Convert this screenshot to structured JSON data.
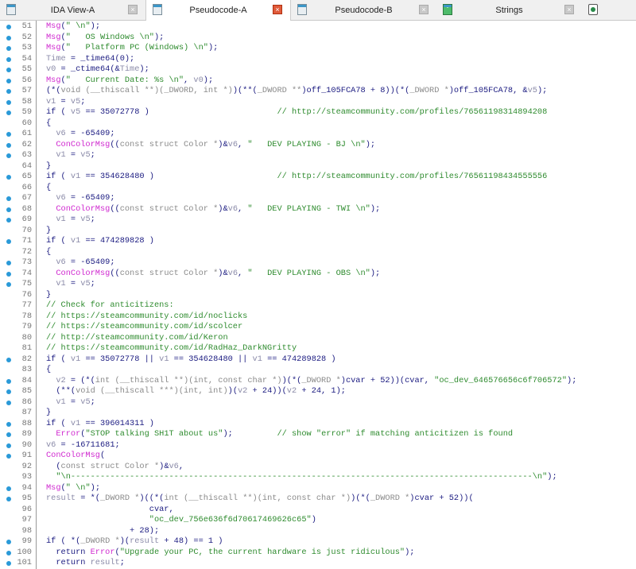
{
  "tabs": [
    {
      "label": "IDA View-A",
      "icon": "disassembly-icon",
      "active": false
    },
    {
      "label": "Pseudocode-A",
      "icon": "pseudocode-icon",
      "active": true
    },
    {
      "label": "Pseudocode-B",
      "icon": "pseudocode-icon",
      "active": false
    },
    {
      "label": "Strings",
      "icon": "strings-icon",
      "active": false
    }
  ],
  "accent": "#2a9ad8",
  "lines": [
    {
      "n": "51",
      "bp": true,
      "seg": [
        [
          "f",
          "Msg"
        ],
        [
          "n",
          "("
        ],
        [
          "s",
          "\" \\n\""
        ],
        [
          "n",
          ");"
        ]
      ]
    },
    {
      "n": "52",
      "bp": true,
      "seg": [
        [
          "f",
          "Msg"
        ],
        [
          "n",
          "("
        ],
        [
          "s",
          "\"   OS Windows \\n\""
        ],
        [
          "n",
          ");"
        ]
      ]
    },
    {
      "n": "53",
      "bp": true,
      "seg": [
        [
          "f",
          "Msg"
        ],
        [
          "n",
          "("
        ],
        [
          "s",
          "\"   Platform PC (Windows) \\n\""
        ],
        [
          "n",
          ");"
        ]
      ]
    },
    {
      "n": "54",
      "bp": true,
      "seg": [
        [
          "v",
          "Time"
        ],
        [
          "n",
          " = _time64(0);"
        ]
      ]
    },
    {
      "n": "55",
      "bp": true,
      "seg": [
        [
          "v",
          "v0"
        ],
        [
          "n",
          " = _ctime64(&"
        ],
        [
          "v",
          "Time"
        ],
        [
          "n",
          ");"
        ]
      ]
    },
    {
      "n": "56",
      "bp": true,
      "seg": [
        [
          "f",
          "Msg"
        ],
        [
          "n",
          "("
        ],
        [
          "s",
          "\"   Current Date: %s \\n\""
        ],
        [
          "n",
          ", "
        ],
        [
          "v",
          "v0"
        ],
        [
          "n",
          ");"
        ]
      ]
    },
    {
      "n": "57",
      "bp": true,
      "seg": [
        [
          "n",
          "(*("
        ],
        [
          "t",
          "void (__thiscall **)(_DWORD, int *)"
        ],
        [
          "n",
          ")(**("
        ],
        [
          "t",
          "_DWORD **"
        ],
        [
          "n",
          ")off_105FCA78 + 8))(*("
        ],
        [
          "t",
          "_DWORD *"
        ],
        [
          "n",
          ")off_105FCA78, &"
        ],
        [
          "v",
          "v5"
        ],
        [
          "n",
          ");"
        ]
      ]
    },
    {
      "n": "58",
      "bp": true,
      "seg": [
        [
          "v",
          "v1"
        ],
        [
          "n",
          " = "
        ],
        [
          "v",
          "v5"
        ],
        [
          "n",
          ";"
        ]
      ]
    },
    {
      "n": "59",
      "bp": true,
      "seg": [
        [
          "n",
          "if ( "
        ],
        [
          "v",
          "v5"
        ],
        [
          "n",
          " == 35072778 )                          "
        ],
        [
          "s",
          "// http://steamcommunity.com/profiles/76561198314894208"
        ]
      ]
    },
    {
      "n": "60",
      "bp": false,
      "seg": [
        [
          "n",
          "{"
        ]
      ]
    },
    {
      "n": "61",
      "bp": true,
      "seg": [
        [
          "n",
          "  "
        ],
        [
          "v",
          "v6"
        ],
        [
          "n",
          " = -65409;"
        ]
      ]
    },
    {
      "n": "62",
      "bp": true,
      "seg": [
        [
          "n",
          "  "
        ],
        [
          "f",
          "ConColorMsg"
        ],
        [
          "n",
          "(("
        ],
        [
          "t",
          "const struct Color *"
        ],
        [
          "n",
          ")&"
        ],
        [
          "v",
          "v6"
        ],
        [
          "n",
          ", "
        ],
        [
          "s",
          "\"   DEV PLAYING - BJ \\n\""
        ],
        [
          "n",
          ");"
        ]
      ]
    },
    {
      "n": "63",
      "bp": true,
      "seg": [
        [
          "n",
          "  "
        ],
        [
          "v",
          "v1"
        ],
        [
          "n",
          " = "
        ],
        [
          "v",
          "v5"
        ],
        [
          "n",
          ";"
        ]
      ]
    },
    {
      "n": "64",
      "bp": false,
      "seg": [
        [
          "n",
          "}"
        ]
      ]
    },
    {
      "n": "65",
      "bp": true,
      "seg": [
        [
          "n",
          "if ( "
        ],
        [
          "v",
          "v1"
        ],
        [
          "n",
          " == 354628480 )                         "
        ],
        [
          "s",
          "// http://steamcommunity.com/profiles/76561198434555556"
        ]
      ]
    },
    {
      "n": "66",
      "bp": false,
      "seg": [
        [
          "n",
          "{"
        ]
      ]
    },
    {
      "n": "67",
      "bp": true,
      "seg": [
        [
          "n",
          "  "
        ],
        [
          "v",
          "v6"
        ],
        [
          "n",
          " = -65409;"
        ]
      ]
    },
    {
      "n": "68",
      "bp": true,
      "seg": [
        [
          "n",
          "  "
        ],
        [
          "f",
          "ConColorMsg"
        ],
        [
          "n",
          "(("
        ],
        [
          "t",
          "const struct Color *"
        ],
        [
          "n",
          ")&"
        ],
        [
          "v",
          "v6"
        ],
        [
          "n",
          ", "
        ],
        [
          "s",
          "\"   DEV PLAYING - TWI \\n\""
        ],
        [
          "n",
          ");"
        ]
      ]
    },
    {
      "n": "69",
      "bp": true,
      "seg": [
        [
          "n",
          "  "
        ],
        [
          "v",
          "v1"
        ],
        [
          "n",
          " = "
        ],
        [
          "v",
          "v5"
        ],
        [
          "n",
          ";"
        ]
      ]
    },
    {
      "n": "70",
      "bp": false,
      "seg": [
        [
          "n",
          "}"
        ]
      ]
    },
    {
      "n": "71",
      "bp": true,
      "seg": [
        [
          "n",
          "if ( "
        ],
        [
          "v",
          "v1"
        ],
        [
          "n",
          " == 474289828 )"
        ]
      ]
    },
    {
      "n": "72",
      "bp": false,
      "seg": [
        [
          "n",
          "{"
        ]
      ]
    },
    {
      "n": "73",
      "bp": true,
      "seg": [
        [
          "n",
          "  "
        ],
        [
          "v",
          "v6"
        ],
        [
          "n",
          " = -65409;"
        ]
      ]
    },
    {
      "n": "74",
      "bp": true,
      "seg": [
        [
          "n",
          "  "
        ],
        [
          "f",
          "ConColorMsg"
        ],
        [
          "n",
          "(("
        ],
        [
          "t",
          "const struct Color *"
        ],
        [
          "n",
          ")&"
        ],
        [
          "v",
          "v6"
        ],
        [
          "n",
          ", "
        ],
        [
          "s",
          "\"   DEV PLAYING - OBS \\n\""
        ],
        [
          "n",
          ");"
        ]
      ]
    },
    {
      "n": "75",
      "bp": true,
      "seg": [
        [
          "n",
          "  "
        ],
        [
          "v",
          "v1"
        ],
        [
          "n",
          " = "
        ],
        [
          "v",
          "v5"
        ],
        [
          "n",
          ";"
        ]
      ]
    },
    {
      "n": "76",
      "bp": false,
      "seg": [
        [
          "n",
          "}"
        ]
      ]
    },
    {
      "n": "77",
      "bp": false,
      "seg": [
        [
          "s",
          "// Check for anticitizens:"
        ]
      ]
    },
    {
      "n": "78",
      "bp": false,
      "seg": [
        [
          "s",
          "// https://steamcommunity.com/id/noclicks"
        ]
      ]
    },
    {
      "n": "79",
      "bp": false,
      "seg": [
        [
          "s",
          "// https://steamcommunity.com/id/scolcer"
        ]
      ]
    },
    {
      "n": "80",
      "bp": false,
      "seg": [
        [
          "s",
          "// http://steamcommunity.com/id/Keron"
        ]
      ]
    },
    {
      "n": "81",
      "bp": false,
      "seg": [
        [
          "s",
          "// https://steamcommunity.com/id/RadHaz_DarkNGritty"
        ]
      ]
    },
    {
      "n": "82",
      "bp": true,
      "seg": [
        [
          "n",
          "if ( "
        ],
        [
          "v",
          "v1"
        ],
        [
          "n",
          " == 35072778 || "
        ],
        [
          "v",
          "v1"
        ],
        [
          "n",
          " == 354628480 || "
        ],
        [
          "v",
          "v1"
        ],
        [
          "n",
          " == 474289828 )"
        ]
      ]
    },
    {
      "n": "83",
      "bp": false,
      "seg": [
        [
          "n",
          "{"
        ]
      ]
    },
    {
      "n": "84",
      "bp": true,
      "seg": [
        [
          "n",
          "  "
        ],
        [
          "v",
          "v2"
        ],
        [
          "n",
          " = (*("
        ],
        [
          "t",
          "int (__thiscall **)(int, const char *)"
        ],
        [
          "n",
          ")(*("
        ],
        [
          "t",
          "_DWORD *"
        ],
        [
          "n",
          ")cvar + 52))(cvar, "
        ],
        [
          "s",
          "\"oc_dev_646576656c6f706572\""
        ],
        [
          "n",
          ");"
        ]
      ]
    },
    {
      "n": "85",
      "bp": true,
      "seg": [
        [
          "n",
          "  (**("
        ],
        [
          "t",
          "void (__thiscall ***)(int, int)"
        ],
        [
          "n",
          ")("
        ],
        [
          "v",
          "v2"
        ],
        [
          "n",
          " + 24))("
        ],
        [
          "v",
          "v2"
        ],
        [
          "n",
          " + 24, 1);"
        ]
      ]
    },
    {
      "n": "86",
      "bp": true,
      "seg": [
        [
          "n",
          "  "
        ],
        [
          "v",
          "v1"
        ],
        [
          "n",
          " = "
        ],
        [
          "v",
          "v5"
        ],
        [
          "n",
          ";"
        ]
      ]
    },
    {
      "n": "87",
      "bp": false,
      "seg": [
        [
          "n",
          "}"
        ]
      ]
    },
    {
      "n": "88",
      "bp": true,
      "seg": [
        [
          "n",
          "if ( "
        ],
        [
          "v",
          "v1"
        ],
        [
          "n",
          " == 396014311 )"
        ]
      ]
    },
    {
      "n": "89",
      "bp": true,
      "seg": [
        [
          "n",
          "  "
        ],
        [
          "f",
          "Error"
        ],
        [
          "n",
          "("
        ],
        [
          "s",
          "\"STOP talking SH1T about us\""
        ],
        [
          "n",
          ");         "
        ],
        [
          "s",
          "// show \"error\" if matching anticitizen is found"
        ]
      ]
    },
    {
      "n": "90",
      "bp": true,
      "seg": [
        [
          "v",
          "v6"
        ],
        [
          "n",
          " = -16711681;"
        ]
      ]
    },
    {
      "n": "91",
      "bp": true,
      "seg": [
        [
          "f",
          "ConColorMsg"
        ],
        [
          "n",
          "("
        ]
      ]
    },
    {
      "n": "92",
      "bp": false,
      "seg": [
        [
          "n",
          "  ("
        ],
        [
          "t",
          "const struct Color *"
        ],
        [
          "n",
          ")&"
        ],
        [
          "v",
          "v6"
        ],
        [
          "n",
          ","
        ]
      ]
    },
    {
      "n": "93",
      "bp": false,
      "seg": [
        [
          "n",
          "  "
        ],
        [
          "s",
          "\"\\n----------------------------------------------------------------------------------------------\\n\""
        ],
        [
          "n",
          ");"
        ]
      ]
    },
    {
      "n": "94",
      "bp": true,
      "seg": [
        [
          "f",
          "Msg"
        ],
        [
          "n",
          "("
        ],
        [
          "s",
          "\" \\n\""
        ],
        [
          "n",
          ");"
        ]
      ]
    },
    {
      "n": "95",
      "bp": true,
      "seg": [
        [
          "v",
          "result"
        ],
        [
          "n",
          " = *("
        ],
        [
          "t",
          "_DWORD *"
        ],
        [
          "n",
          ")((*("
        ],
        [
          "t",
          "int (__thiscall **)(int, const char *)"
        ],
        [
          "n",
          ")(*("
        ],
        [
          "t",
          "_DWORD *"
        ],
        [
          "n",
          ")cvar + 52))("
        ]
      ]
    },
    {
      "n": "96",
      "bp": false,
      "seg": [
        [
          "n",
          "                     cvar,"
        ]
      ]
    },
    {
      "n": "97",
      "bp": false,
      "seg": [
        [
          "n",
          "                     "
        ],
        [
          "s",
          "\"oc_dev_756e636f6d70617469626c65\""
        ],
        [
          "n",
          ")"
        ]
      ]
    },
    {
      "n": "98",
      "bp": false,
      "seg": [
        [
          "n",
          "                 + 28);"
        ]
      ]
    },
    {
      "n": "99",
      "bp": true,
      "seg": [
        [
          "n",
          "if ( *("
        ],
        [
          "t",
          "_DWORD *"
        ],
        [
          "n",
          ")("
        ],
        [
          "v",
          "result"
        ],
        [
          "n",
          " + 48) == 1 )"
        ]
      ]
    },
    {
      "n": "100",
      "bp": true,
      "seg": [
        [
          "n",
          "  return "
        ],
        [
          "f",
          "Error"
        ],
        [
          "n",
          "("
        ],
        [
          "s",
          "\"Upgrade your PC, the current hardware is just ridiculous\""
        ],
        [
          "n",
          ");"
        ]
      ]
    },
    {
      "n": "101",
      "bp": true,
      "seg": [
        [
          "n",
          "  return "
        ],
        [
          "v",
          "result"
        ],
        [
          "n",
          ";"
        ]
      ]
    }
  ]
}
